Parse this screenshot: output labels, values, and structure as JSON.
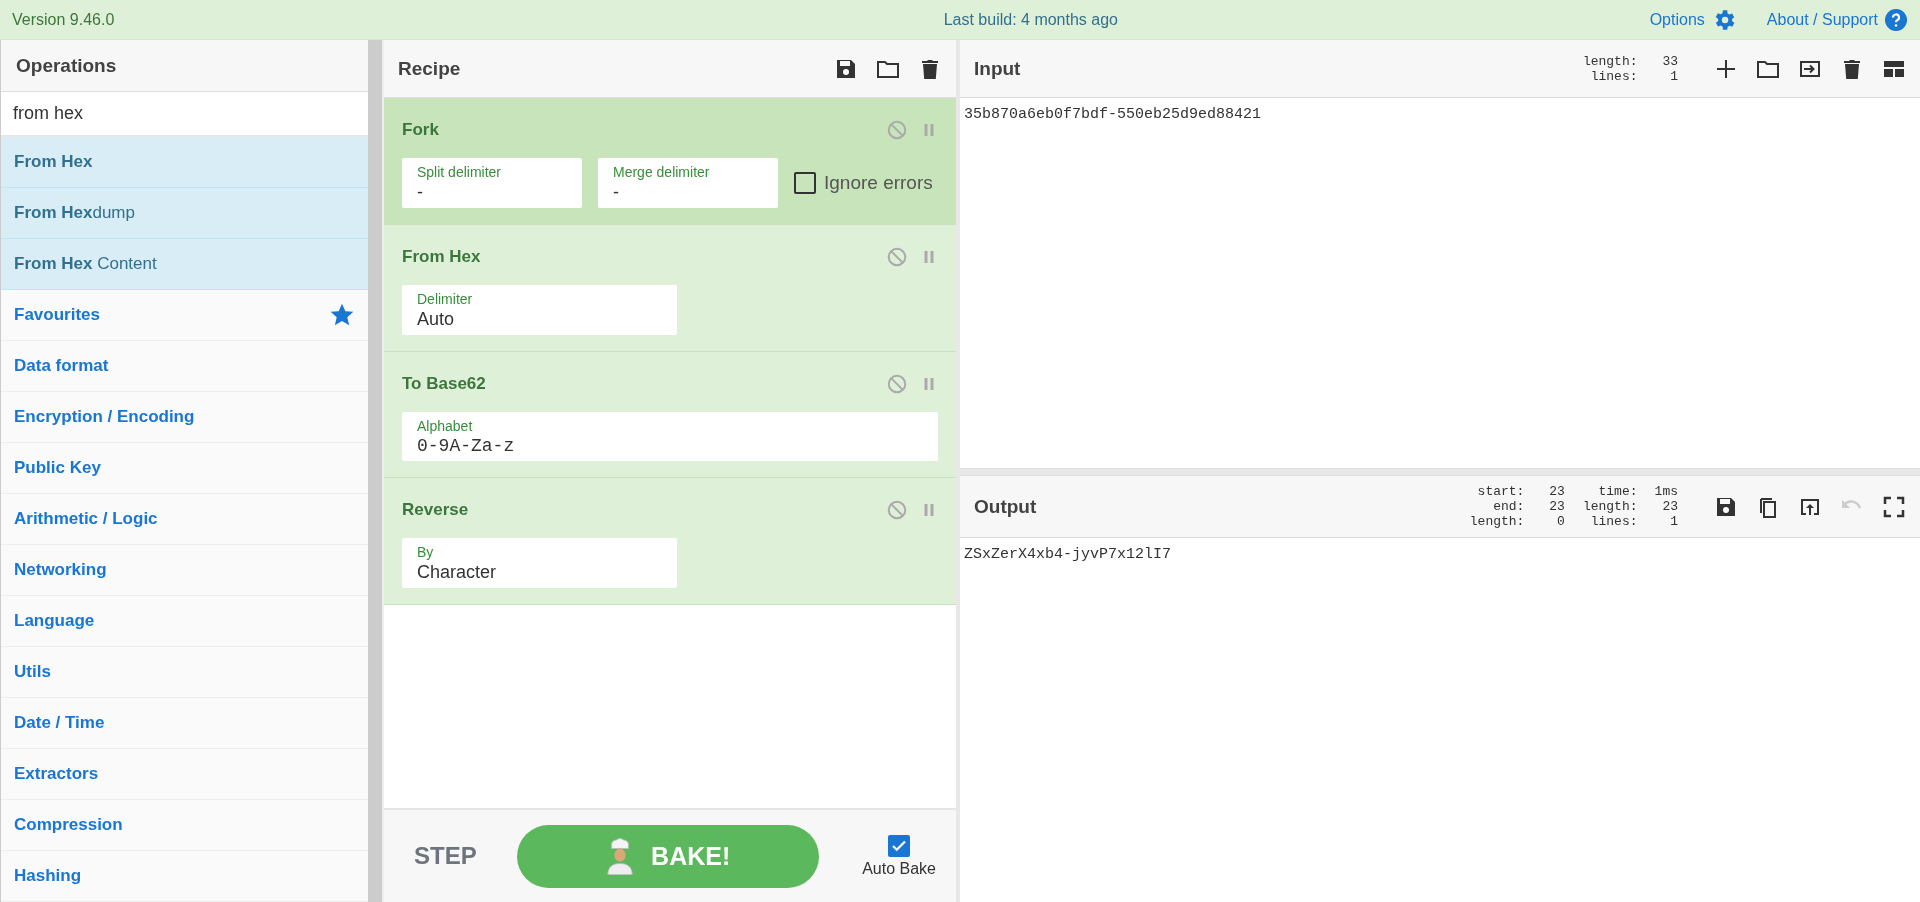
{
  "banner": {
    "version": "Version 9.46.0",
    "last_build": "Last build: 4 months ago",
    "options": "Options",
    "about": "About / Support"
  },
  "operations": {
    "title": "Operations",
    "search": {
      "value": "from hex"
    },
    "items": [
      {
        "kind": "result",
        "match": "From Hex"
      },
      {
        "kind": "result",
        "match": "From Hex",
        "rest": "dump"
      },
      {
        "kind": "result",
        "match": "From Hex",
        "rest": " Content"
      },
      {
        "kind": "favourites",
        "label": "Favourites"
      },
      {
        "kind": "category",
        "label": "Data format"
      },
      {
        "kind": "category",
        "label": "Encryption / Encoding"
      },
      {
        "kind": "category",
        "label": "Public Key"
      },
      {
        "kind": "category",
        "label": "Arithmetic / Logic"
      },
      {
        "kind": "category",
        "label": "Networking"
      },
      {
        "kind": "category",
        "label": "Language"
      },
      {
        "kind": "category",
        "label": "Utils"
      },
      {
        "kind": "category",
        "label": "Date / Time"
      },
      {
        "kind": "category",
        "label": "Extractors"
      },
      {
        "kind": "category",
        "label": "Compression"
      },
      {
        "kind": "category",
        "label": "Hashing"
      }
    ]
  },
  "recipe": {
    "title": "Recipe",
    "operations": [
      {
        "kind": "flow",
        "name": "Fork",
        "args": [
          {
            "kind": "text",
            "label": "Split delimiter",
            "value": "-"
          },
          {
            "kind": "text",
            "label": "Merge delimiter",
            "value": "-"
          },
          {
            "kind": "checkbox",
            "label": "Ignore errors",
            "checked": false
          }
        ]
      },
      {
        "kind": "operation",
        "name": "From Hex",
        "args": [
          {
            "kind": "select",
            "label": "Delimiter",
            "value": "Auto"
          }
        ]
      },
      {
        "kind": "operation",
        "name": "To Base62",
        "args": [
          {
            "kind": "code",
            "label": "Alphabet",
            "value": "0-9A-Za-z"
          }
        ]
      },
      {
        "kind": "operation",
        "name": "Reverse",
        "args": [
          {
            "kind": "select",
            "label": "By",
            "value": "Character"
          }
        ]
      }
    ],
    "step": "STEP",
    "bake": "BAKE!",
    "auto_bake": {
      "label": "Auto Bake",
      "checked": true
    }
  },
  "input": {
    "title": "Input",
    "stats": [
      {
        "label": "length:",
        "value": "33"
      },
      {
        "label": "lines:",
        "value": "1"
      }
    ],
    "text": "35b870a6eb0f7bdf-550eb25d9ed88421"
  },
  "output": {
    "title": "Output",
    "stats": [
      {
        "label": "start:",
        "value": "23"
      },
      {
        "label": "end:",
        "value": "23"
      },
      {
        "label": "length:",
        "value": "0"
      },
      {
        "label": "time:",
        "value": "1ms"
      },
      {
        "label": "length:",
        "value": "23"
      },
      {
        "label": "lines:",
        "value": "1"
      }
    ],
    "toolbar": [
      {
        "kind": "save",
        "disabled": false
      },
      {
        "kind": "copy",
        "disabled": false
      },
      {
        "kind": "replace-input",
        "disabled": false
      },
      {
        "kind": "undo",
        "disabled": true
      },
      {
        "kind": "maximise",
        "disabled": false
      }
    ],
    "text": "ZSxZerX4xb4-jyvP7x12lI7"
  }
}
